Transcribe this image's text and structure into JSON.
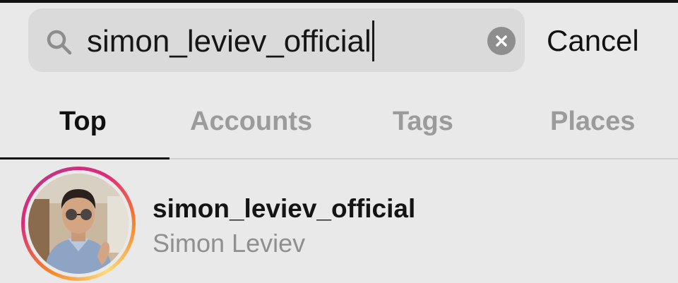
{
  "search": {
    "query": "simon_leviev_official",
    "cancel_label": "Cancel"
  },
  "tabs": [
    {
      "label": "Top",
      "active": true
    },
    {
      "label": "Accounts",
      "active": false
    },
    {
      "label": "Tags",
      "active": false
    },
    {
      "label": "Places",
      "active": false
    }
  ],
  "results": [
    {
      "username": "simon_leviev_official",
      "full_name": "Simon Leviev",
      "avatar_icon": "profile-photo"
    }
  ],
  "icons": {
    "search": "search-icon",
    "clear": "close-icon"
  },
  "colors": {
    "background": "#e9e9e9",
    "search_field": "#dadada",
    "inactive_tab": "#9b9b9b",
    "active_tab": "#111111",
    "story_ring_start": "#f58529",
    "story_ring_end": "#dd2a7b"
  }
}
